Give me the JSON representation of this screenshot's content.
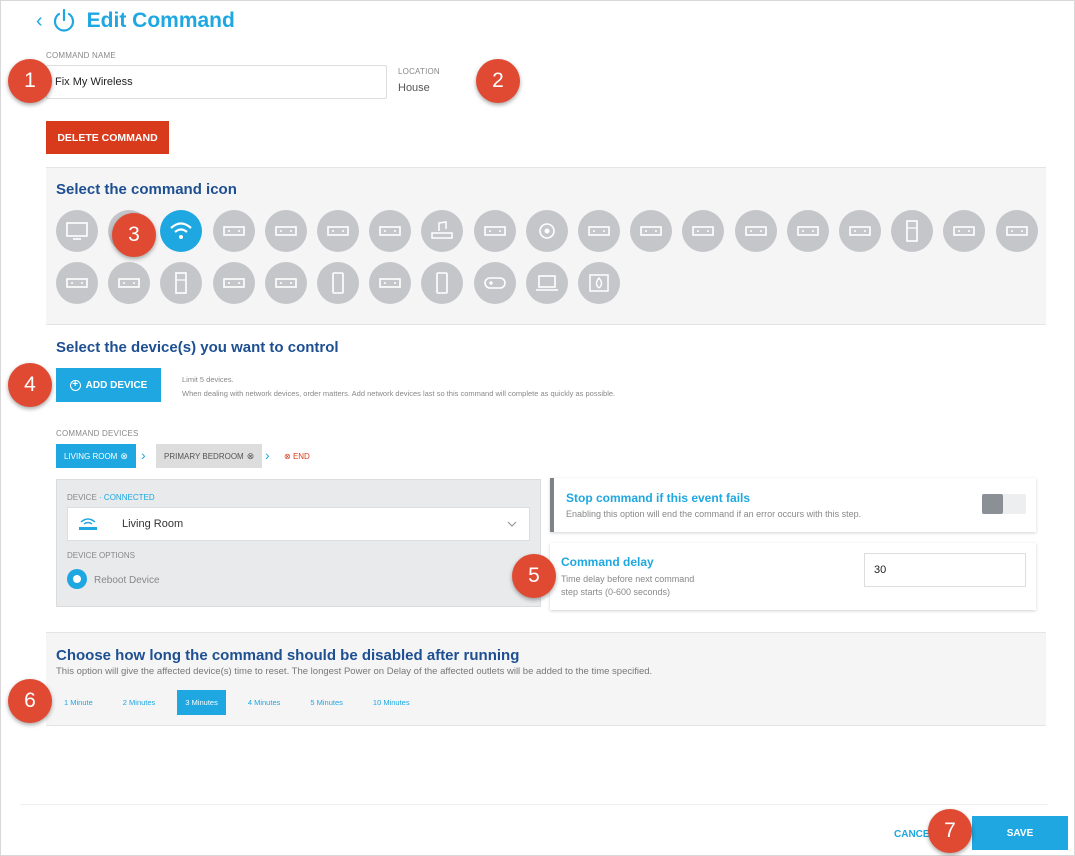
{
  "header": {
    "title": "Edit Command"
  },
  "command_name": {
    "label": "COMMAND NAME",
    "value": "Fix My Wireless"
  },
  "location": {
    "label": "LOCATION",
    "value": "House"
  },
  "delete_button": "DELETE COMMAND",
  "icon_section": {
    "title": "Select the command icon",
    "icons": [
      "tv-icon",
      "blank-icon",
      "wifi-icon",
      "router-icon",
      "wireless-router-icon",
      "modem-icon",
      "access-point-icon",
      "audio-icon",
      "satellite-icon",
      "camera-icon",
      "network-jack-icon",
      "switch-icon",
      "nas-icon",
      "av-receiver-icon",
      "smart-home-icon",
      "antenna-router-icon",
      "tower-pc-icon",
      "wifi-range-icon",
      "cable-box-icon",
      "dvd-player-icon",
      "game-console-box-icon",
      "fridge-icon",
      "pos-terminal-icon",
      "projector-screen-icon",
      "tablet-icon",
      "projector-icon",
      "phone-icon",
      "gamepad-icon",
      "laptop-icon",
      "firewall-icon"
    ],
    "selected": "wifi-icon"
  },
  "devices_section": {
    "title": "Select the device(s) you want to control",
    "add_button": "ADD DEVICE",
    "limit": "Limit 5 devices.",
    "hint": "When dealing with network devices, order matters. Add network devices last so this command will complete as quickly as possible.",
    "command_devices_label": "COMMAND DEVICES",
    "chips": [
      "LIVING ROOM",
      "PRIMARY BEDROOM"
    ],
    "end_label": "END",
    "device_label": "DEVICE",
    "device_status": "CONNECTED",
    "device_value": "Living Room",
    "options_label": "DEVICE OPTIONS",
    "option_value": "Reboot Device"
  },
  "stop_card": {
    "title": "Stop command if this event fails",
    "desc": "Enabling this option will end the command if an error occurs with this step.",
    "enabled": false
  },
  "delay_card": {
    "title": "Command delay",
    "desc_line1": "Time delay before next command",
    "desc_line2": "step starts (0-600 seconds)",
    "value": "30"
  },
  "disable_section": {
    "title": "Choose how long the command should be disabled after running",
    "desc": "This option will give the affected device(s) time to reset. The longest Power on Delay of the affected outlets will be added to the time specified.",
    "options": [
      "1 Minute",
      "2 Minutes",
      "3 Minutes",
      "4 Minutes",
      "5 Minutes",
      "10 Minutes"
    ],
    "selected": "3 Minutes"
  },
  "footer": {
    "cancel": "CANCEL",
    "save": "SAVE"
  },
  "callouts": [
    "1",
    "2",
    "3",
    "4",
    "5",
    "6",
    "7"
  ],
  "colors": {
    "accent": "#1ea7e0",
    "danger": "#d83a1c",
    "heading": "#1d4f91",
    "callout": "#e04a32"
  }
}
